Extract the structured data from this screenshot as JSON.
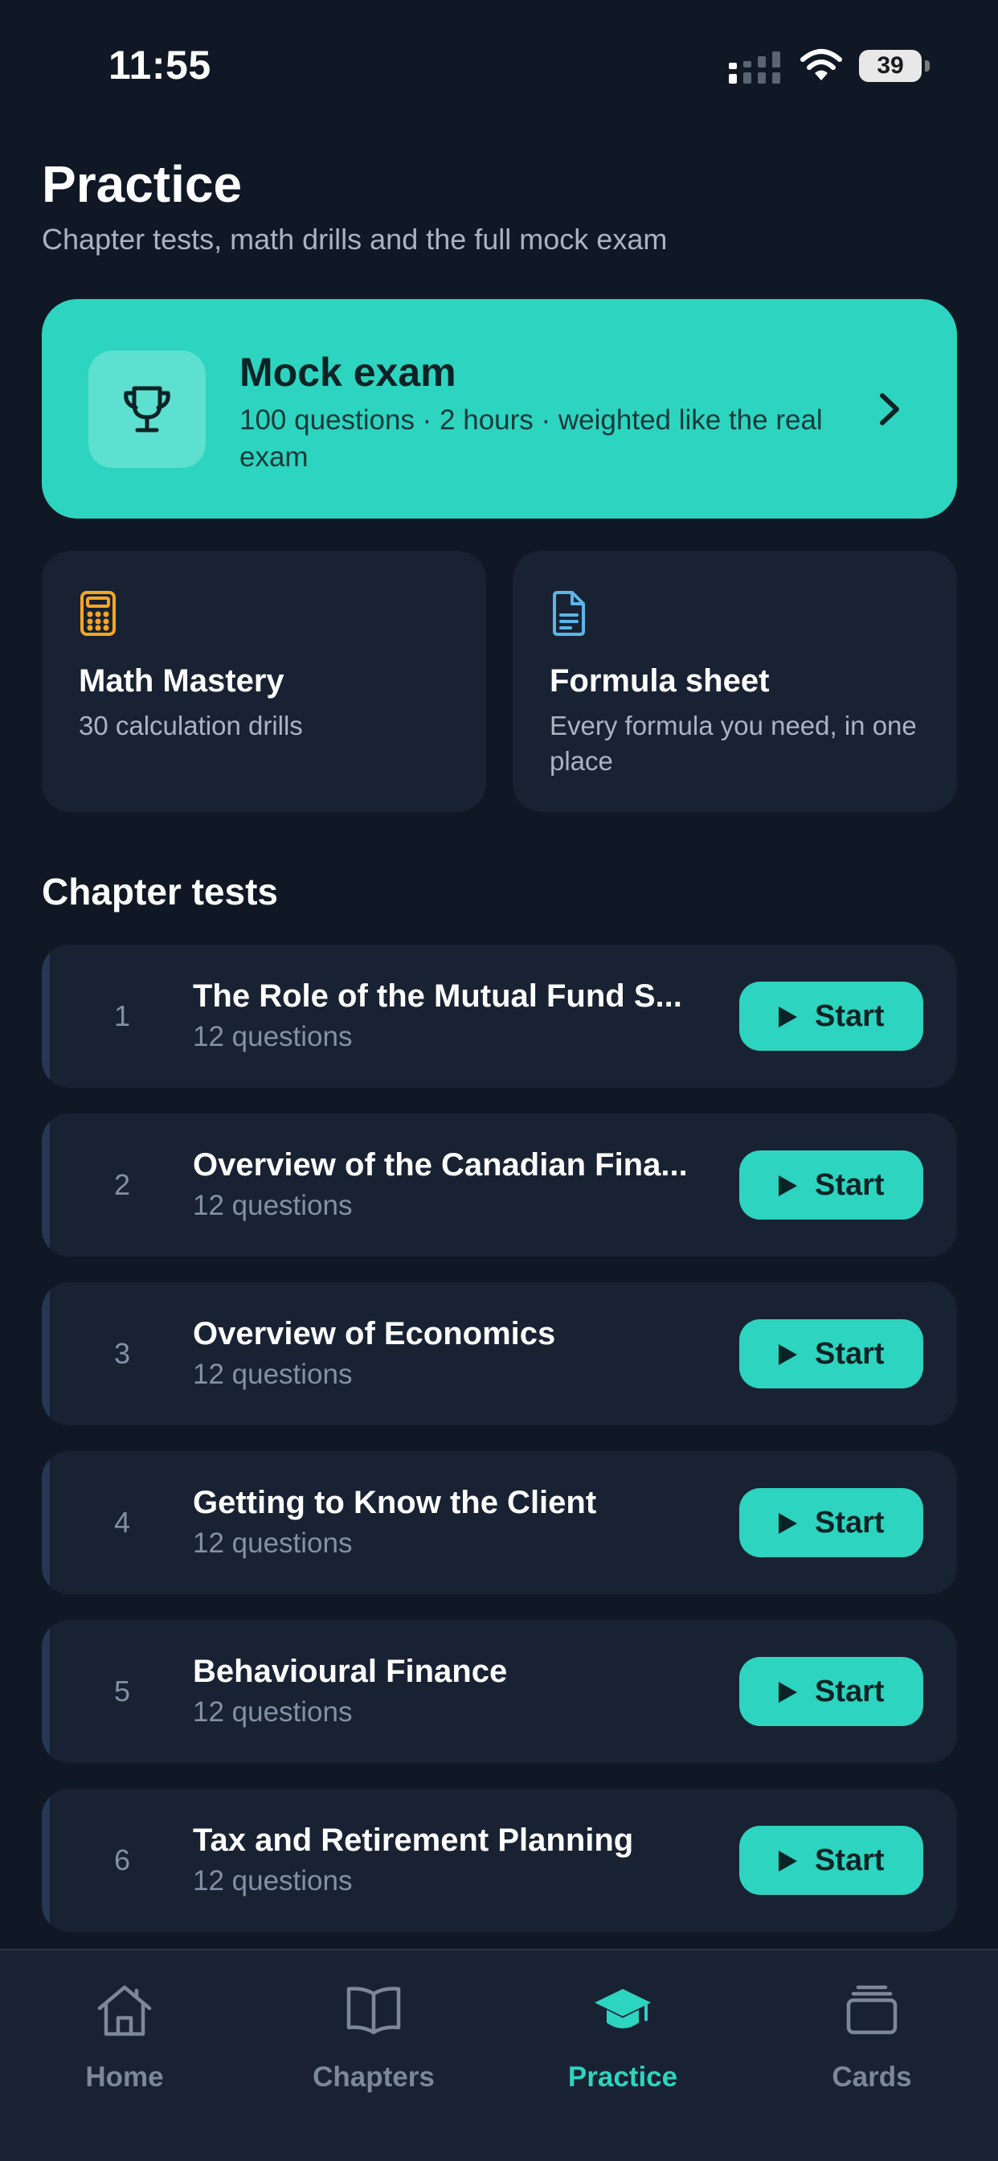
{
  "status_bar": {
    "time": "11:55",
    "battery": "39"
  },
  "header": {
    "title": "Practice",
    "subtitle": "Chapter tests, math drills and the full mock exam"
  },
  "mock_exam": {
    "title": "Mock exam",
    "description": "100 questions · 2 hours · weighted like the real exam",
    "icon": "trophy-icon"
  },
  "tiles": {
    "math": {
      "title": "Math Mastery",
      "description": "30 calculation drills",
      "icon": "calculator-icon"
    },
    "formula": {
      "title": "Formula sheet",
      "description": "Every formula you need, in one place",
      "icon": "document-icon"
    }
  },
  "chapter_tests": {
    "title": "Chapter tests",
    "start_label": "Start",
    "items": [
      {
        "number": "1",
        "title": "The Role of the Mutual Fund S...",
        "count": "12 questions"
      },
      {
        "number": "2",
        "title": "Overview of the Canadian Fina...",
        "count": "12 questions"
      },
      {
        "number": "3",
        "title": "Overview of Economics",
        "count": "12 questions"
      },
      {
        "number": "4",
        "title": "Getting to Know the Client",
        "count": "12 questions"
      },
      {
        "number": "5",
        "title": "Behavioural Finance",
        "count": "12 questions"
      },
      {
        "number": "6",
        "title": "Tax and Retirement Planning",
        "count": "12 questions"
      }
    ]
  },
  "nav": {
    "items": [
      {
        "label": "Home",
        "icon": "home-icon",
        "active": false
      },
      {
        "label": "Chapters",
        "icon": "book-icon",
        "active": false
      },
      {
        "label": "Practice",
        "icon": "graduation-cap-icon",
        "active": true
      },
      {
        "label": "Cards",
        "icon": "cards-icon",
        "active": false
      }
    ]
  },
  "colors": {
    "background": "#0f1824",
    "card": "#182232",
    "accent": "#2dd4bf",
    "muted_text": "#a9b4c2",
    "math_icon": "#f5a524",
    "formula_icon": "#5bb5e8"
  }
}
